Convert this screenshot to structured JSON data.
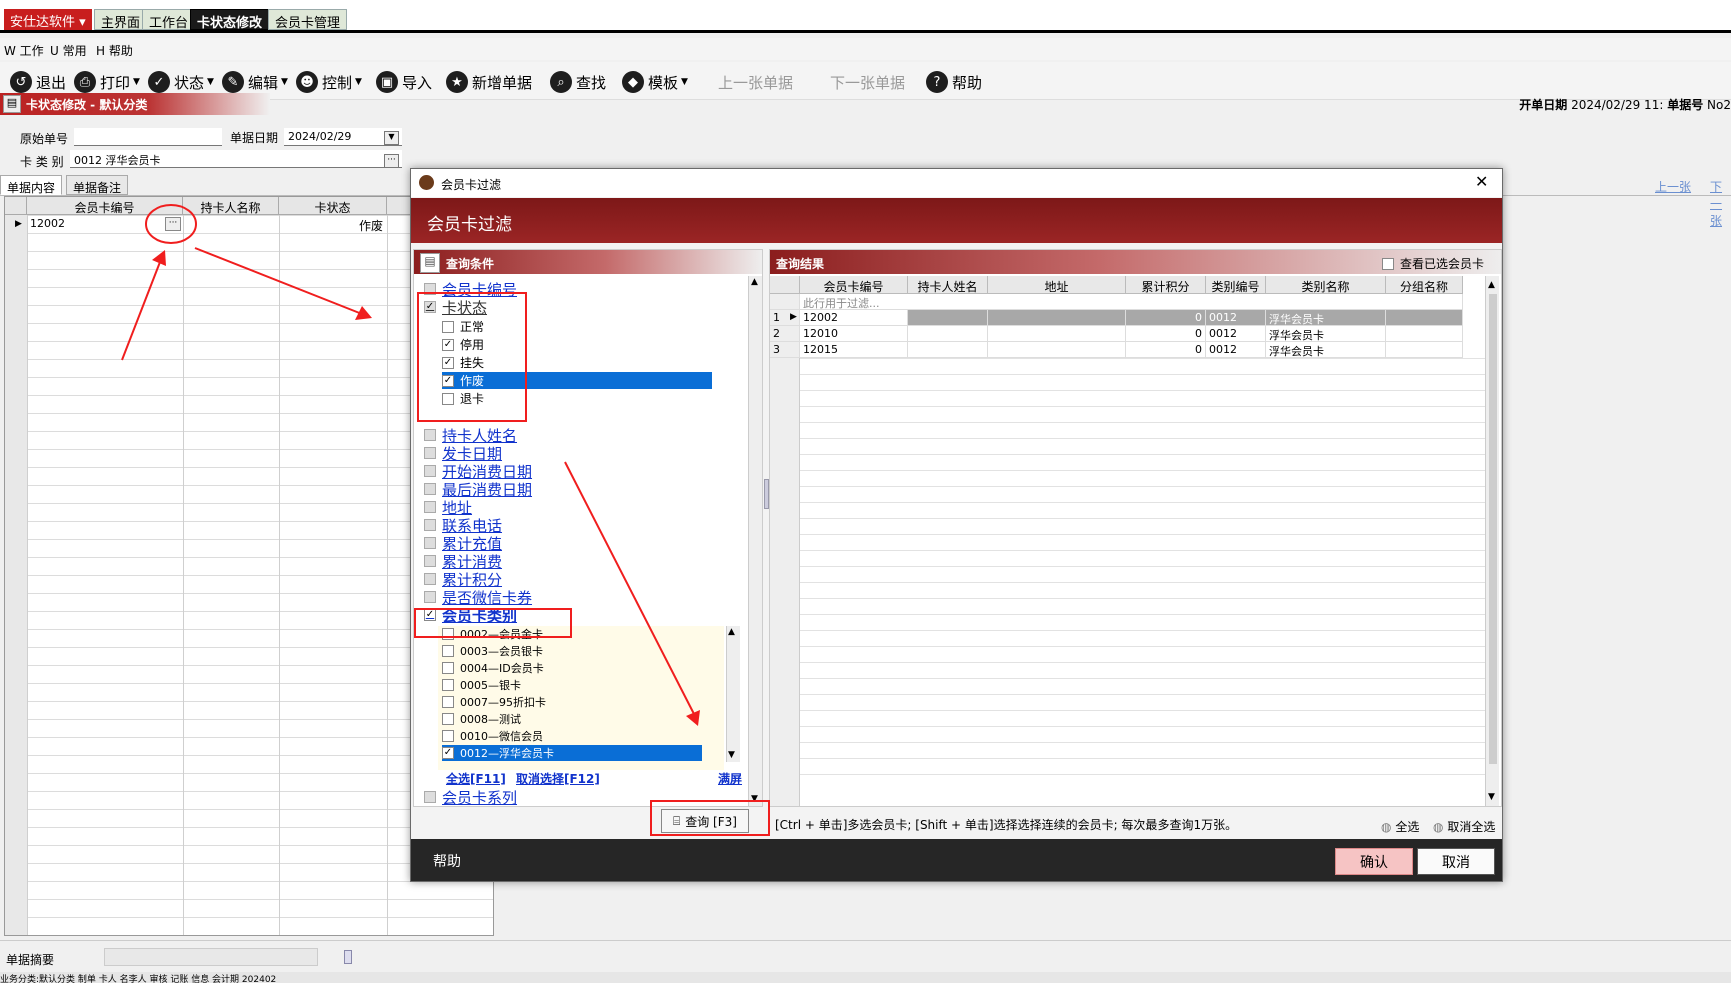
{
  "topbar": {
    "app_menu": "安仕达软件",
    "tabs": [
      "主界面",
      "工作台",
      "卡状态修改",
      "会员卡管理"
    ]
  },
  "menubar": {
    "items": [
      "W 工作",
      "U 常用",
      "H 帮助"
    ]
  },
  "toolbar": {
    "exit": "退出",
    "print": "打印",
    "status": "状态",
    "edit": "编辑",
    "control": "控制",
    "import": "导入",
    "new": "新增单据",
    "find": "查找",
    "template": "模板",
    "prev": "上一张单据",
    "next": "下一张单据",
    "help": "帮助"
  },
  "page": {
    "subtitle": "卡状态修改 - 默认分类",
    "open_date_label": "开单日期",
    "open_date_value": "2024/02/29 11:",
    "doc_no_label": "单据号",
    "doc_no_value": "No2"
  },
  "form": {
    "orig_no_label": "原始单号",
    "orig_no_value": "",
    "doc_date_label": "单据日期",
    "doc_date_value": "2024/02/29",
    "card_type_label": "卡 类 别",
    "card_type_value": "0012 浮华会员卡"
  },
  "doc_tabs": [
    "单据内容",
    "单据备注"
  ],
  "top_right_links": {
    "prev": "上一张",
    "next": "下一张"
  },
  "grid": {
    "columns": [
      "会员卡编号",
      "持卡人名称",
      "卡状态"
    ],
    "rows": [
      {
        "card_no": "12002",
        "holder": "",
        "status": "作废"
      }
    ],
    "ellipsis": "···"
  },
  "summary": {
    "label": "单据摘要"
  },
  "statusbar": {
    "text": "业务分类:默认分类  制单  卡人  名李人  审核  记账  信息  会计期 202402"
  },
  "dialog": {
    "title": "会员卡过滤",
    "banner": "会员卡过滤",
    "conditions_header": "查询条件",
    "conditions": [
      {
        "label": "会员卡编号",
        "checked": false
      },
      {
        "label": "卡状态",
        "checked": true
      },
      {
        "label": "持卡人姓名",
        "checked": false
      },
      {
        "label": "发卡日期",
        "checked": false
      },
      {
        "label": "开始消费日期",
        "checked": false
      },
      {
        "label": "最后消费日期",
        "checked": false
      },
      {
        "label": "地址",
        "checked": false
      },
      {
        "label": "联系电话",
        "checked": false
      },
      {
        "label": "累计充值",
        "checked": false
      },
      {
        "label": "累计消费",
        "checked": false
      },
      {
        "label": "累计积分",
        "checked": false
      },
      {
        "label": "是否微信卡券",
        "checked": false
      },
      {
        "label": "会员卡类别",
        "checked": true
      },
      {
        "label": "会员卡系列",
        "checked": false
      }
    ],
    "status_options": [
      {
        "label": "正常",
        "checked": false
      },
      {
        "label": "停用",
        "checked": true
      },
      {
        "label": "挂失",
        "checked": true
      },
      {
        "label": "作废",
        "checked": true,
        "selected": true
      },
      {
        "label": "退卡",
        "checked": false
      }
    ],
    "card_types": [
      {
        "label": "0002—会员金卡",
        "checked": false
      },
      {
        "label": "0003—会员银卡",
        "checked": false
      },
      {
        "label": "0004—ID会员卡",
        "checked": false
      },
      {
        "label": "0005—银卡",
        "checked": false
      },
      {
        "label": "0007—95折扣卡",
        "checked": false
      },
      {
        "label": "0008—测试",
        "checked": false
      },
      {
        "label": "0010—微信会员",
        "checked": false
      },
      {
        "label": "0012—浮华会员卡",
        "checked": true,
        "selected": true
      }
    ],
    "select_all": "全选[F11]",
    "deselect": "取消选择[F12]",
    "fullscreen": "满屏",
    "results_header": "查询结果",
    "view_selected": "查看已选会员卡",
    "result_columns": [
      "会员卡编号",
      "持卡人姓名",
      "地址",
      "累计积分",
      "类别编号",
      "类别名称",
      "分组名称"
    ],
    "filter_placeholder": "此行用于过滤...",
    "results": [
      {
        "idx": "1",
        "card_no": "12002",
        "holder": "",
        "address": "",
        "points": "0",
        "type_no": "0012",
        "type_name": "浮华会员卡",
        "group": ""
      },
      {
        "idx": "2",
        "card_no": "12010",
        "holder": "",
        "address": "",
        "points": "0",
        "type_no": "0012",
        "type_name": "浮华会员卡",
        "group": ""
      },
      {
        "idx": "3",
        "card_no": "12015",
        "holder": "",
        "address": "",
        "points": "0",
        "type_no": "0012",
        "type_name": "浮华会员卡",
        "group": ""
      }
    ],
    "query_button": "查询 [F3]",
    "hint": "[Ctrl + 单击]多选会员卡; [Shift + 单击]选择选择连续的会员卡; 每次最多查询1万张。",
    "all_select": "全选",
    "all_deselect": "取消全选",
    "help": "帮助",
    "ok": "确认",
    "cancel": "取消"
  },
  "colors": {
    "brand_red": "#c81e1e",
    "banner": "#8b1d1d",
    "selection": "#0a6ed6",
    "annotation": "#f01e1e"
  }
}
